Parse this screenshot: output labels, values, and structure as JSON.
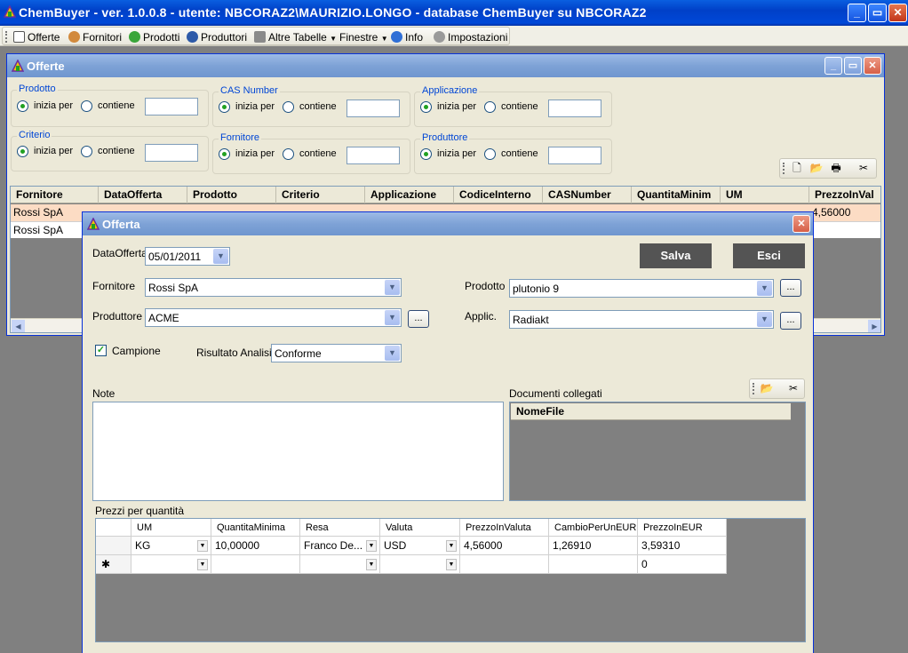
{
  "app": {
    "title": "ChemBuyer - ver. 1.0.0.8 - utente: NBCORAZ2\\MAURIZIO.LONGO - database ChemBuyer su NBCORAZ2",
    "caption_min": "_",
    "caption_max": "▭",
    "caption_close": "✕"
  },
  "menu": {
    "items": [
      "Offerte",
      "Fornitori",
      "Prodotti",
      "Produttori",
      "Altre Tabelle",
      "Finestre",
      "Info",
      "Impostazioni"
    ]
  },
  "offerte_window": {
    "title": "Offerte",
    "filters": [
      {
        "label": "Prodotto",
        "opt1": "inizia per",
        "opt2": "contiene"
      },
      {
        "label": "CAS Number",
        "opt1": "inizia per",
        "opt2": "contiene"
      },
      {
        "label": "Applicazione",
        "opt1": "inizia per",
        "opt2": "contiene"
      },
      {
        "label": "Criterio",
        "opt1": "inizia per",
        "opt2": "contiene"
      },
      {
        "label": "Fornitore",
        "opt1": "inizia per",
        "opt2": "contiene"
      },
      {
        "label": "Produttore",
        "opt1": "inizia per",
        "opt2": "contiene"
      }
    ],
    "columns": [
      "Fornitore",
      "DataOfferta",
      "Prodotto",
      "Criterio",
      "Applicazione",
      "CodiceInterno",
      "CASNumber",
      "QuantitaMinim",
      "UM",
      "PrezzoInVal"
    ],
    "rows": [
      {
        "fornitore": "Rossi SpA",
        "prezzo": "4,56000"
      },
      {
        "fornitore": "Rossi SpA",
        "prezzo": ""
      }
    ]
  },
  "offerta_dialog": {
    "title": "Offerta",
    "data_offerta_label": "DataOfferta",
    "data_offerta": "05/01/2011",
    "salva": "Salva",
    "esci": "Esci",
    "fornitore_label": "Fornitore",
    "fornitore": "Rossi SpA",
    "prodotto_label": "Prodotto",
    "prodotto": "plutonio 9",
    "produttore_label": "Produttore",
    "produttore": "ACME",
    "applic_label": "Applic.",
    "applic": "Radiakt",
    "browse": "...",
    "campione_label": "Campione",
    "campione_checked": true,
    "risultato_label": "Risultato Analisi",
    "risultato": "Conforme",
    "note_label": "Note",
    "documenti_label": "Documenti collegati",
    "documenti_column": "NomeFile",
    "prezzi_label": "Prezzi per quantità",
    "prezzi_columns": [
      "UM",
      "QuantitaMinima",
      "Resa",
      "Valuta",
      "PrezzoInValuta",
      "CambioPerUnEUR(",
      "PrezzoInEUR"
    ],
    "prezzi_rows": [
      [
        "KG",
        "10,00000",
        "Franco De...",
        "USD",
        "4,56000",
        "1,26910",
        "3,59310"
      ],
      [
        "",
        "",
        "",
        "",
        "",
        "",
        "0"
      ]
    ],
    "new_row_marker": "✱"
  }
}
